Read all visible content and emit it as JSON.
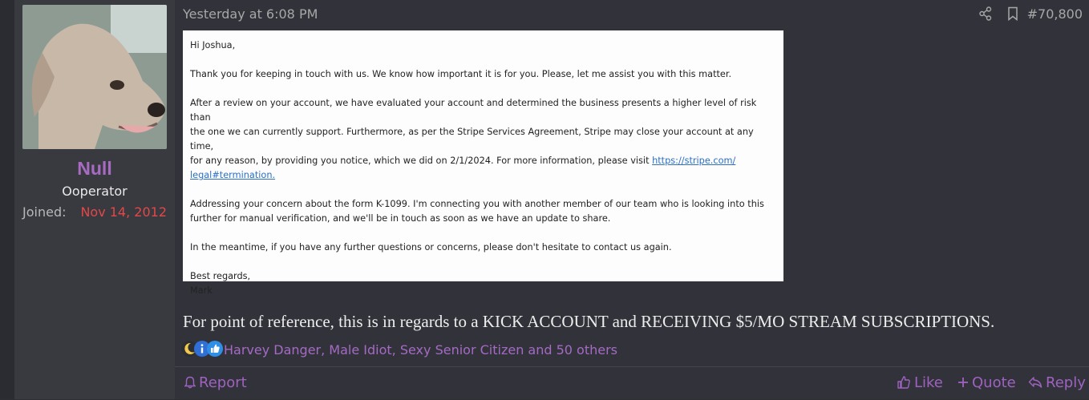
{
  "user": {
    "name": "Null",
    "title": "Ooperator",
    "joined_label": "Joined:",
    "joined_date": "Nov 14, 2012"
  },
  "post": {
    "timestamp": "Yesterday at 6:08 PM",
    "number": "#70,800",
    "body": "For point of reference, this is in regards to a KICK ACCOUNT and RECEIVING $5/MO STREAM SUBSCRIPTIONS."
  },
  "email": {
    "greeting": "Hi Joshua,",
    "para1": "Thank you for keeping in touch with us. We know how important it is for you. Please, let me assist you with this matter.",
    "para2_line1": "After a review on your account, we have evaluated your account and determined the business presents a higher level of risk than",
    "para2_line2": "the one we can currently support. Furthermore, as per the Stripe Services Agreement, Stripe may close your account at any time,",
    "para2_line3": "for any reason, by providing you notice, which we did on 2/1/2024. For more information, please visit ",
    "link_part1": "https://stripe.com/",
    "link_part2": "legal#termination.",
    "para3_line1": "Addressing your concern about the form K-1099. I'm connecting you with another member of our team who is looking into this",
    "para3_line2": "further for manual verification, and we'll be in touch as soon as we have an update to share.",
    "para4": "In the meantime, if you have any further questions or concerns, please don't hesitate to contact us again.",
    "signoff": "Best regards,",
    "signature": "Mark"
  },
  "reactions": {
    "names": "Harvey Danger, Male Idiot, Sexy Senior Citizen and 50 others",
    "icons": [
      "moon-icon",
      "info-icon",
      "thumbs-up-icon"
    ]
  },
  "footer": {
    "report": "Report",
    "like": "Like",
    "quote": "Quote",
    "reply": "Reply"
  },
  "colors": {
    "username": "#a76bc2",
    "joined_date": "#e24848",
    "action": "#9f62c0"
  }
}
